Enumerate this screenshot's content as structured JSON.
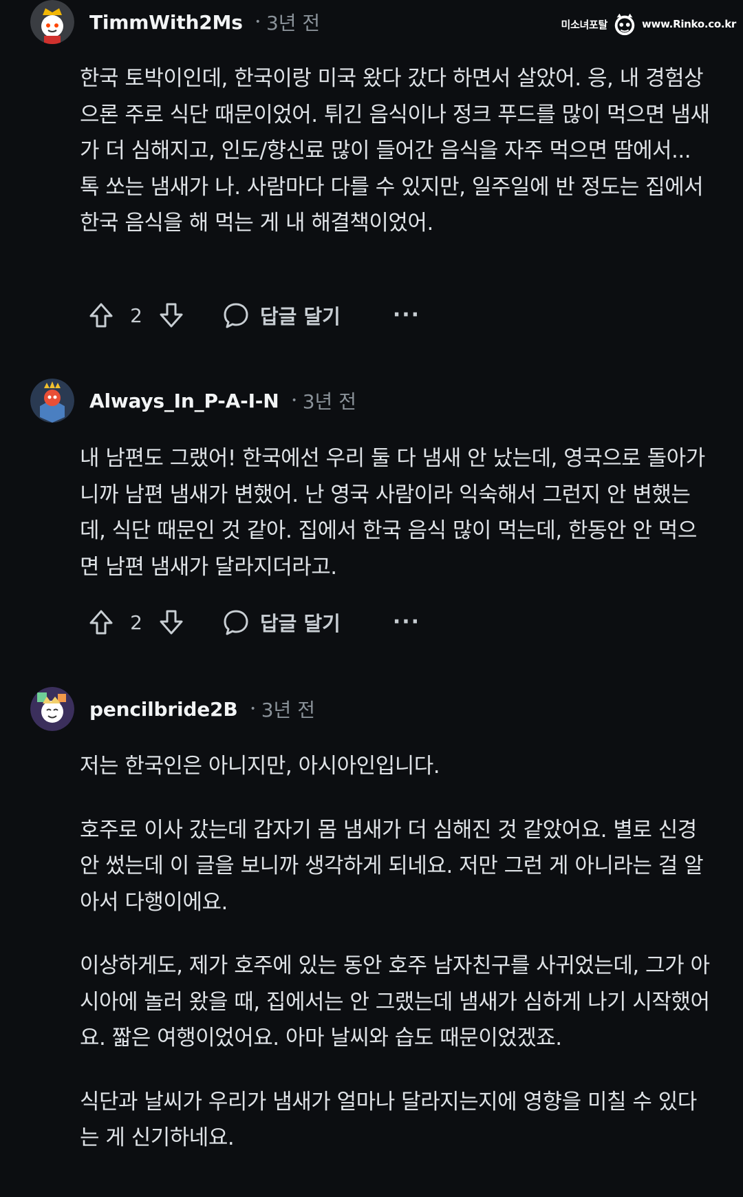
{
  "watermark": {
    "site_name": "미소녀포탈",
    "url": "www.Rinko.co.kr"
  },
  "colors": {
    "background": "#0c0e11",
    "text": "#dfe3e7",
    "muted": "#8a9299",
    "username": "#f2f4f5"
  },
  "comments": [
    {
      "username": "TimmWith2Ms",
      "separator": "•",
      "time": "3년 전",
      "paragraphs": [
        "한국 토박이인데, 한국이랑 미국 왔다 갔다 하면서 살았어. 응, 내 경험상으론 주로 식단 때문이었어. 튀긴 음식이나 정크 푸드를 많이 먹으면 냄새가 더 심해지고, 인도/향신료 많이 들어간 음식을 자주 먹으면 땀에서... 톡 쏘는 냄새가 나. 사람마다 다를 수 있지만, 일주일에 반 정도는 집에서 한국 음식을 해 먹는 게 내 해결책이었어."
      ],
      "votes": "2",
      "reply_label": "답글 달기",
      "more_label": "···"
    },
    {
      "username": "Always_In_P-A-I-N",
      "separator": "•",
      "time": "3년 전",
      "paragraphs": [
        "내 남편도 그랬어! 한국에선 우리 둘 다 냄새 안 났는데, 영국으로 돌아가니까 남편 냄새가 변했어. 난 영국 사람이라 익숙해서 그런지 안 변했는데, 식단 때문인 것 같아. 집에서 한국 음식 많이 먹는데, 한동안 안 먹으면 남편 냄새가 달라지더라고."
      ],
      "votes": "2",
      "reply_label": "답글 달기",
      "more_label": "···"
    },
    {
      "username": "pencilbride2B",
      "separator": "•",
      "time": "3년 전",
      "paragraphs": [
        "저는 한국인은 아니지만, 아시아인입니다.",
        "호주로 이사 갔는데 갑자기 몸 냄새가 더 심해진 것 같았어요. 별로 신경 안 썼는데 이 글을 보니까 생각하게 되네요. 저만 그런 게 아니라는 걸 알아서 다행이에요.",
        "이상하게도, 제가 호주에 있는 동안 호주 남자친구를 사귀었는데, 그가 아시아에 놀러 왔을 때, 집에서는 안 그랬는데 냄새가 심하게 나기 시작했어요. 짧은 여행이었어요. 아마 날씨와 습도 때문이었겠죠.",
        "식단과 날씨가 우리가 냄새가 얼마나 달라지는지에 영향을 미칠 수 있다는 게 신기하네요."
      ]
    }
  ]
}
